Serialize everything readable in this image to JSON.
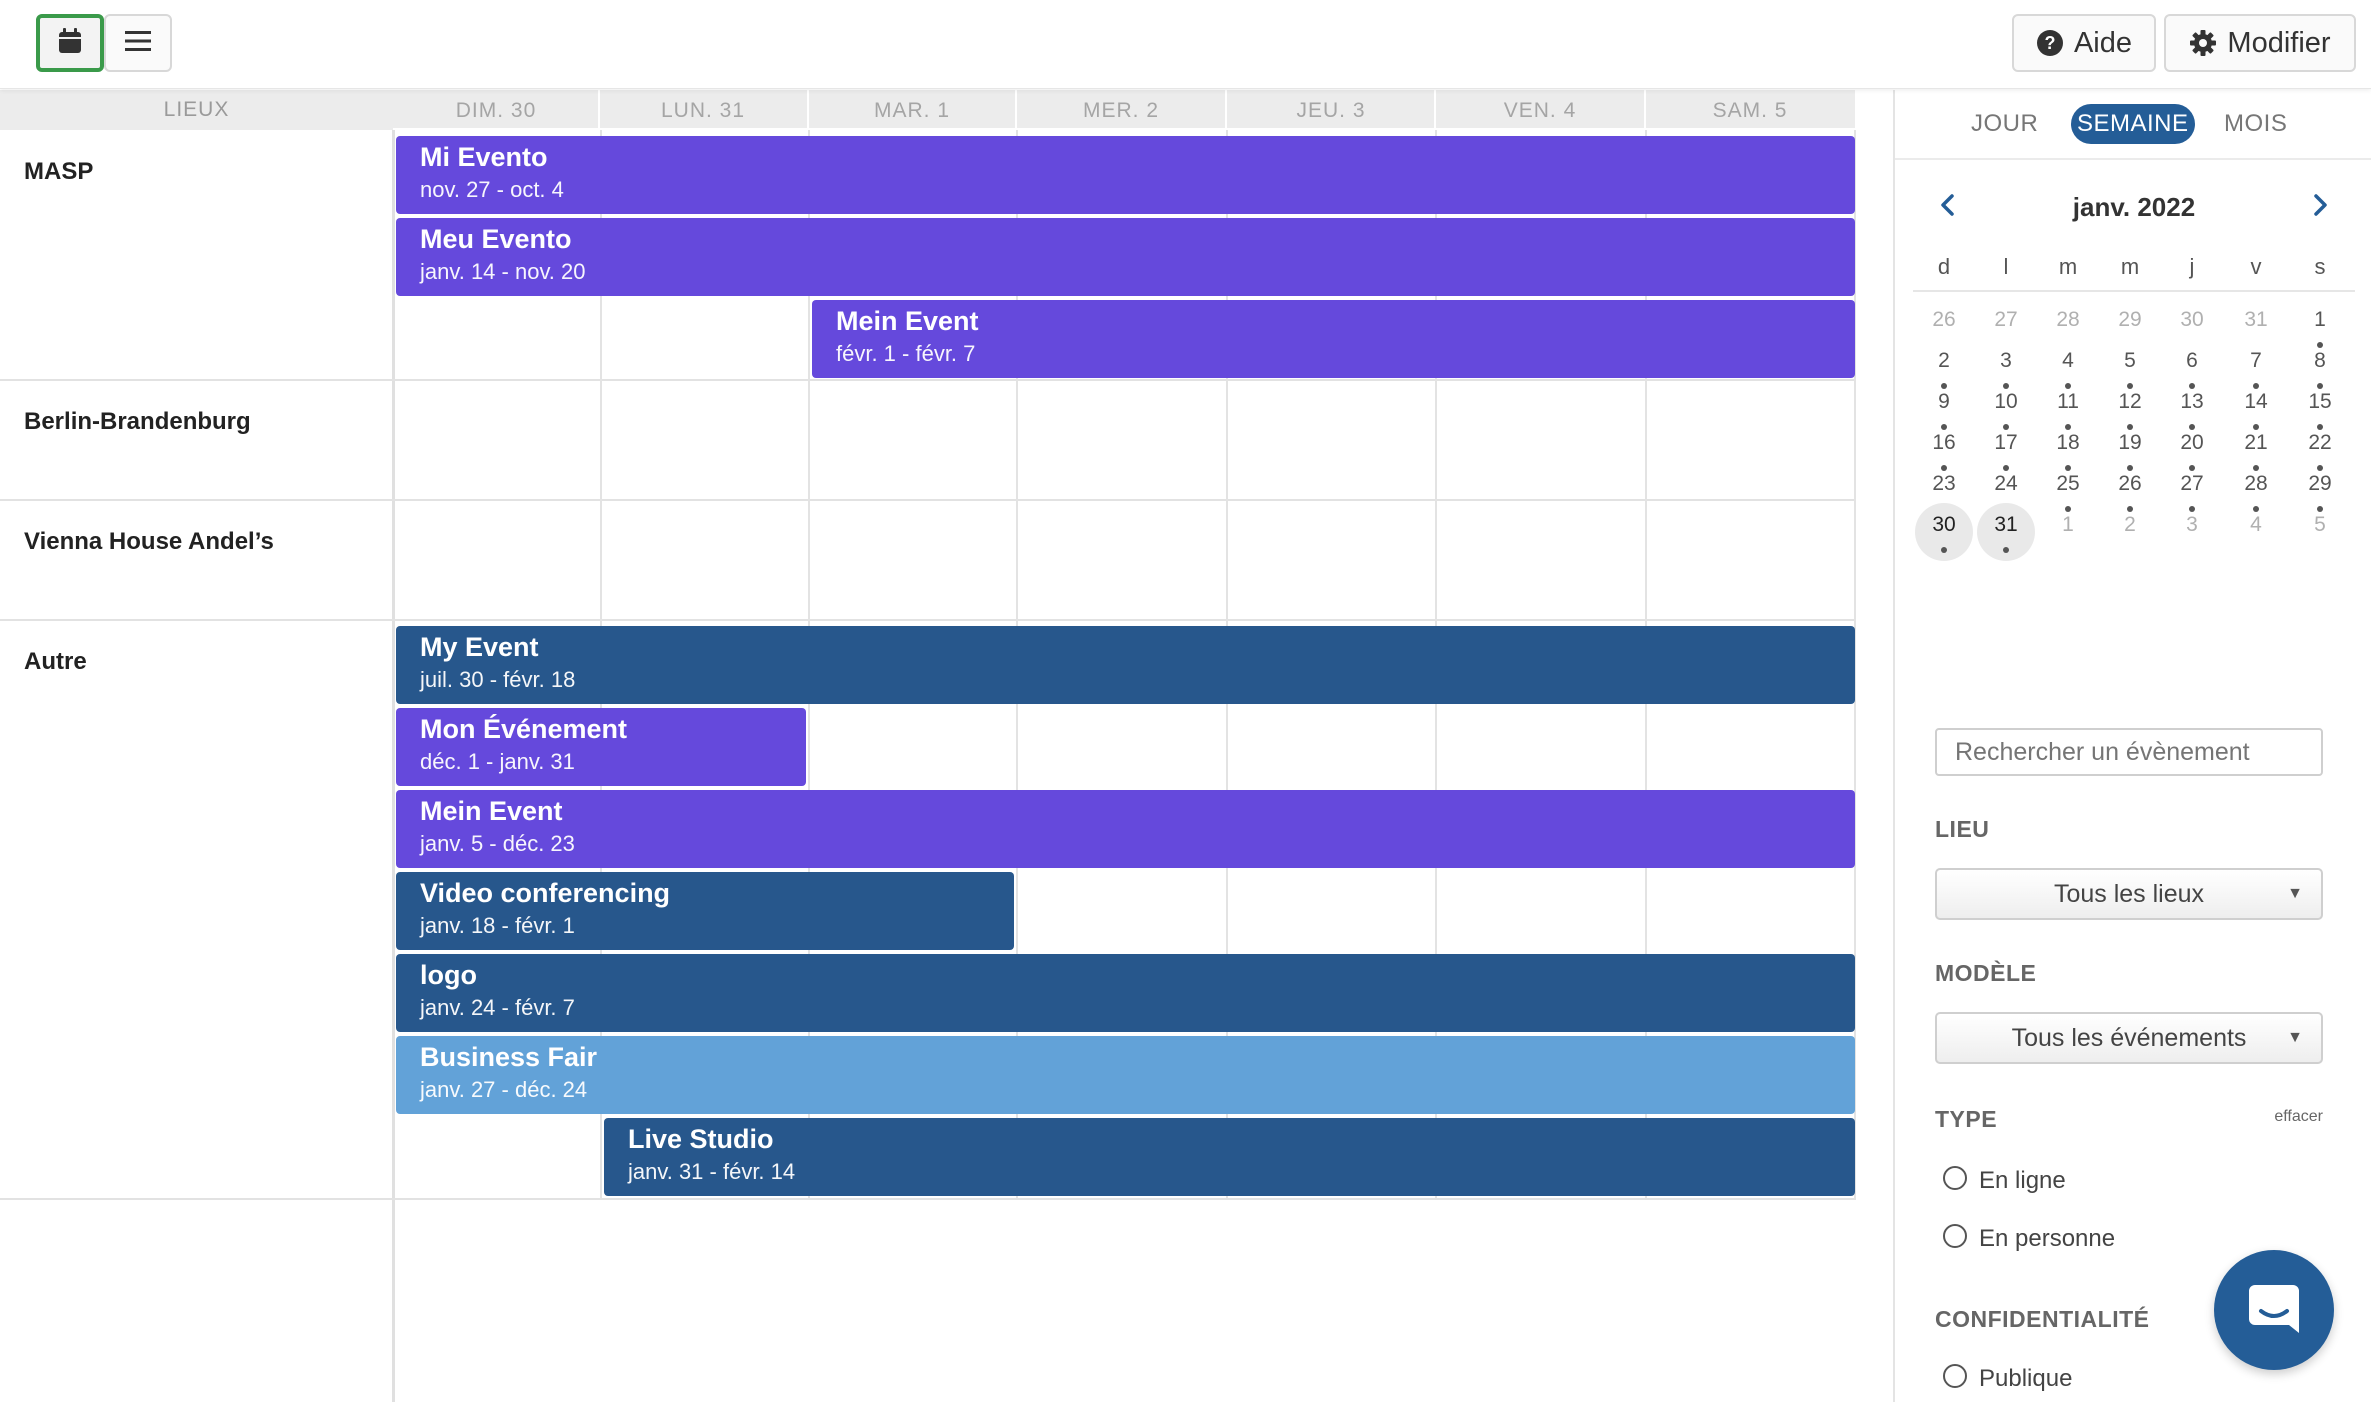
{
  "toolbar": {
    "calendar_view_icon": "calendar-icon",
    "list_view_icon": "list-icon",
    "help_label": "Aide",
    "help_icon": "question-circle-icon",
    "edit_label": "Modifier",
    "edit_icon": "gear-icon"
  },
  "scheduler": {
    "venues_header": "LIEUX",
    "days": [
      "DIM. 30",
      "LUN. 31",
      "MAR. 1",
      "MER. 2",
      "JEU. 3",
      "VEN. 4",
      "SAM. 5"
    ],
    "venues": [
      {
        "name": "MASP"
      },
      {
        "name": "Berlin-Brandenburg"
      },
      {
        "name": "Vienna House Andel’s"
      },
      {
        "name": "Autre"
      }
    ],
    "events": [
      {
        "title": "Mi Evento",
        "dates": "nov. 27 - oct. 4",
        "color": "#6549dc"
      },
      {
        "title": "Meu Evento",
        "dates": "janv. 14 - nov. 20",
        "color": "#6549dc"
      },
      {
        "title": "Mein Event",
        "dates": "févr. 1 - févr. 7",
        "color": "#6549dc"
      },
      {
        "title": "My Event",
        "dates": "juil. 30 - févr. 18",
        "color": "#27578c"
      },
      {
        "title": "Mon Événement",
        "dates": "déc. 1 - janv. 31",
        "color": "#6549dc"
      },
      {
        "title": "Mein Event",
        "dates": "janv. 5 - déc. 23",
        "color": "#6549dc"
      },
      {
        "title": "Video conferencing",
        "dates": "janv. 18 - févr. 1",
        "color": "#27578c"
      },
      {
        "title": "logo",
        "dates": "janv. 24 - févr. 7",
        "color": "#27578c"
      },
      {
        "title": "Business Fair",
        "dates": "janv. 27 - déc. 24",
        "color": "#62a2d8"
      },
      {
        "title": "Live Studio",
        "dates": "janv. 31 - févr. 14",
        "color": "#27578c"
      }
    ]
  },
  "side_panel": {
    "view_tabs": [
      {
        "label": "JOUR",
        "active": false
      },
      {
        "label": "SEMAINE",
        "active": true
      },
      {
        "label": "MOIS",
        "active": false
      }
    ],
    "mini_calendar": {
      "month_label": "janv. 2022",
      "weekdays": [
        "d",
        "l",
        "m",
        "m",
        "j",
        "v",
        "s"
      ],
      "weeks": [
        [
          "26",
          "27",
          "28",
          "29",
          "30",
          "31",
          "1"
        ],
        [
          "2",
          "3",
          "4",
          "5",
          "6",
          "7",
          "8"
        ],
        [
          "9",
          "10",
          "11",
          "12",
          "13",
          "14",
          "15"
        ],
        [
          "16",
          "17",
          "18",
          "19",
          "20",
          "21",
          "22"
        ],
        [
          "23",
          "24",
          "25",
          "26",
          "27",
          "28",
          "29"
        ],
        [
          "30",
          "31",
          "1",
          "2",
          "3",
          "4",
          "5"
        ]
      ]
    },
    "search": {
      "placeholder": "Rechercher un évènement"
    },
    "venue_filter": {
      "label": "LIEU",
      "value": "Tous les lieux"
    },
    "template_filter": {
      "label": "MODÈLE",
      "value": "Tous les événements"
    },
    "type_filter": {
      "label": "TYPE",
      "clear_label": "effacer",
      "options": [
        "En ligne",
        "En personne"
      ]
    },
    "privacy_filter": {
      "label": "CONFIDENTIALITÉ",
      "options": [
        "Publique"
      ]
    }
  },
  "chat": {
    "icon": "chat-bubble-icon"
  },
  "colors": {
    "accent": "#245d97",
    "purple_event": "#6549dc",
    "blue_event": "#27578c",
    "light_blue_event": "#62a2d8",
    "active_view_border": "#3a9a4a"
  }
}
